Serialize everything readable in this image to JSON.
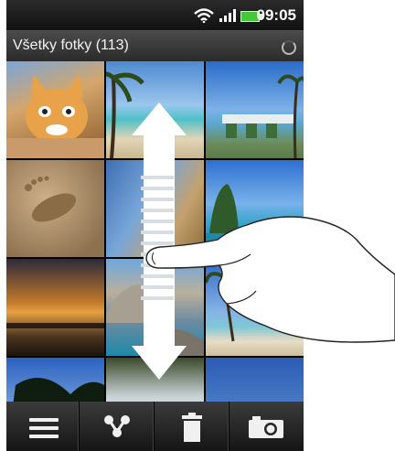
{
  "status_bar": {
    "time": "09:05",
    "icons": [
      "wifi-icon",
      "signal-icon",
      "battery-icon"
    ]
  },
  "header": {
    "title": "Všetky fotky (113)",
    "loading_icon": "spinner-icon"
  },
  "gallery": {
    "photos": [
      {
        "id": "cat"
      },
      {
        "id": "palm-beach"
      },
      {
        "id": "table-by-sea"
      },
      {
        "id": "footprint-sand"
      },
      {
        "id": "beach-sky"
      },
      {
        "id": "island-cliff"
      },
      {
        "id": "sunset"
      },
      {
        "id": "rocks-beach"
      },
      {
        "id": "palm-shore"
      },
      {
        "id": "palms-sky"
      },
      {
        "id": "waterfall"
      },
      {
        "id": "blue-sky"
      }
    ]
  },
  "toolbar": {
    "buttons": [
      {
        "icon": "menu-icon"
      },
      {
        "icon": "share-icon"
      },
      {
        "icon": "trash-icon"
      },
      {
        "icon": "camera-icon"
      }
    ]
  },
  "gesture_hint": {
    "icons": [
      "scroll-arrow-icon",
      "hand-pointer-icon"
    ]
  },
  "colors": {
    "battery": "#45c83a",
    "header_bg": "#3a3a3a",
    "toolbar_bg": "#262626"
  }
}
